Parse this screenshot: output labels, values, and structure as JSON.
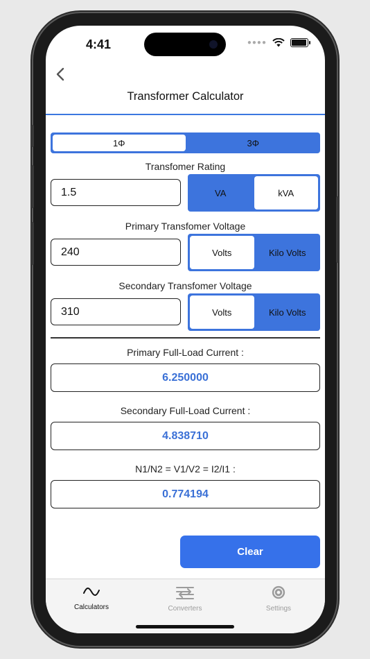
{
  "status": {
    "time": "4:41"
  },
  "nav": {
    "title": "Transformer Calculator",
    "back_icon": "chevron-left-icon"
  },
  "phase": {
    "options": [
      "1Φ",
      "3Φ"
    ],
    "selected": "1Φ"
  },
  "rating": {
    "label": "Transfomer Rating",
    "value": "1.5",
    "units": [
      "VA",
      "kVA"
    ],
    "selected": "kVA"
  },
  "primary": {
    "label": "Primary Transfomer Voltage",
    "value": "240",
    "units": [
      "Volts",
      "Kilo Volts"
    ],
    "selected": "Volts"
  },
  "secondary": {
    "label": "Secondary Transfomer Voltage",
    "value": "310",
    "units": [
      "Volts",
      "Kilo Volts"
    ],
    "selected": "Volts"
  },
  "results": {
    "primary_label": "Primary Full-Load Current :",
    "primary_value": "6.250000",
    "secondary_label": "Secondary Full-Load Current :",
    "secondary_value": "4.838710",
    "ratio_label": "N1/N2 = V1/V2 = I2/I1 :",
    "ratio_value": "0.774194"
  },
  "actions": {
    "clear_label": "Clear"
  },
  "tabs": [
    {
      "label": "Calculators",
      "icon": "wave-icon",
      "active": true
    },
    {
      "label": "Converters",
      "icon": "swap-arrows-icon",
      "active": false
    },
    {
      "label": "Settings",
      "icon": "gear-icon",
      "active": false
    }
  ],
  "colors": {
    "accent": "#3671ea",
    "result_text": "#3a70d6"
  }
}
